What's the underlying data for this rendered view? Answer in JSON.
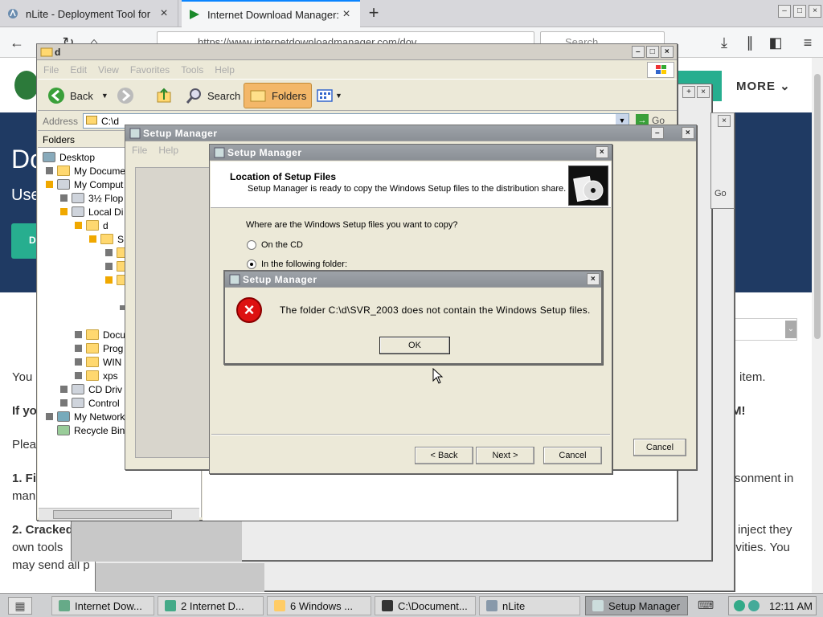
{
  "browser": {
    "tabs": [
      {
        "label": "nLite - Deployment Tool for"
      },
      {
        "label": "Internet Download Manager:"
      }
    ],
    "url": "https://www.internetdownloadmanager.com/dov",
    "search_placeholder": "Search"
  },
  "webpage": {
    "more_label": "MORE",
    "hero_title": "Do",
    "hero_sub": "Use",
    "hero_button": "D",
    "lines": [
      {
        "left": "You",
        "right": "item."
      },
      {
        "left": "If yo",
        "right": "M!"
      },
      {
        "left": "Plea",
        "right": ""
      },
      {
        "left": "1. Fi",
        "right": "sonment in"
      },
      {
        "left": "man",
        "right": ""
      },
      {
        "left": "2. Cracked",
        "right": "inject they"
      },
      {
        "left": "own tools",
        "right": "ivities. You"
      },
      {
        "left": "may send all p",
        "right": ""
      }
    ]
  },
  "explorer": {
    "title": "d",
    "menu": [
      "File",
      "Edit",
      "View",
      "Favorites",
      "Tools",
      "Help"
    ],
    "toolbar": {
      "back": "Back",
      "search": "Search",
      "folders": "Folders"
    },
    "address_label": "Address",
    "address_value": "C:\\d",
    "go_label": "Go",
    "folders_header": "Folders",
    "tree": [
      {
        "label": "Desktop"
      },
      {
        "label": "My Docume"
      },
      {
        "label": "My Comput"
      },
      {
        "label": "3½ Flop"
      },
      {
        "label": "Local Di"
      },
      {
        "label": "d"
      },
      {
        "label": "S"
      },
      {
        "label": ""
      },
      {
        "label": ""
      },
      {
        "label": ""
      },
      {
        "label": "Docu"
      },
      {
        "label": "Prog"
      },
      {
        "label": "WIN"
      },
      {
        "label": "xps"
      },
      {
        "label": "CD Driv"
      },
      {
        "label": "Control"
      },
      {
        "label": "My Network"
      },
      {
        "label": "Recycle Bin"
      }
    ]
  },
  "setup_back": {
    "title": "Setup Manager",
    "menu": [
      "File",
      "Help"
    ],
    "cancel": "Cancel"
  },
  "wizard": {
    "title": "Setup Manager",
    "header_title": "Location of Setup Files",
    "header_subtitle": "Setup Manager is ready to copy the Windows Setup files to the distribution share.",
    "question": "Where are the Windows Setup files you want to copy?",
    "option_cd": "On the CD",
    "option_folder": "In the following folder:",
    "back": "< Back",
    "next": "Next >",
    "cancel": "Cancel"
  },
  "error_dialog": {
    "title": "Setup Manager",
    "message": "The folder C:\\d\\SVR_2003 does not contain the Windows Setup files.",
    "ok": "OK"
  },
  "taskbar": {
    "items": [
      {
        "label": "Internet Dow..."
      },
      {
        "label": "2 Internet D..."
      },
      {
        "label": "6 Windows ..."
      },
      {
        "label": "C:\\Document..."
      },
      {
        "label": "nLite"
      },
      {
        "label": "Setup Manager"
      }
    ],
    "clock": "12:11 AM"
  },
  "colors": {
    "accent_green": "#27ae8f",
    "hero_blue": "#1f3a63",
    "error_red": "#d11111"
  }
}
